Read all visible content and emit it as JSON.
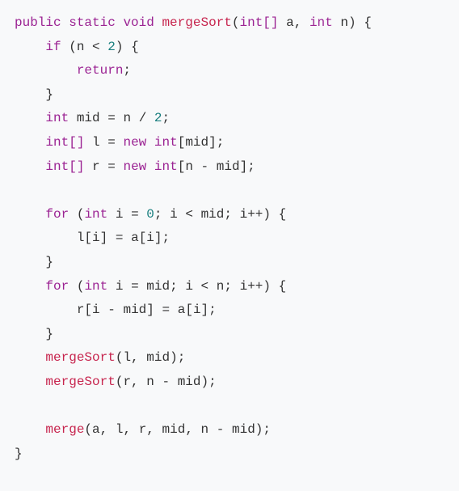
{
  "kw": {
    "public": "public",
    "static": "static",
    "void": "void",
    "if": "if",
    "return": "return",
    "new": "new",
    "for": "for"
  },
  "type": {
    "int": "int",
    "intarr": "int[]"
  },
  "func": {
    "mergeSort": "mergeSort",
    "merge": "merge"
  },
  "ident": {
    "a": "a",
    "n": "n",
    "mid": "mid",
    "l": "l",
    "r": "r",
    "i": "i"
  },
  "num": {
    "two": "2",
    "zero": "0"
  },
  "op": {
    "lt": "<",
    "eq": "=",
    "div": "/",
    "minus": "-",
    "pp": "++"
  },
  "punct": {
    "lparen": "(",
    "rparen": ")",
    "lbrace": "{",
    "rbrace": "}",
    "lbracket": "[",
    "rbracket": "]",
    "semi": ";",
    "comma": ","
  },
  "chart_data": {
    "type": "table",
    "title": "Java mergeSort function source code",
    "lines": [
      "public static void mergeSort(int[] a, int n) {",
      "    if (n < 2) {",
      "        return;",
      "    }",
      "    int mid = n / 2;",
      "    int[] l = new int[mid];",
      "    int[] r = new int[n - mid];",
      "",
      "    for (int i = 0; i < mid; i++) {",
      "        l[i] = a[i];",
      "    }",
      "    for (int i = mid; i < n; i++) {",
      "        r[i - mid] = a[i];",
      "    }",
      "    mergeSort(l, mid);",
      "    mergeSort(r, n - mid);",
      "",
      "    merge(a, l, r, mid, n - mid);",
      "}"
    ]
  }
}
